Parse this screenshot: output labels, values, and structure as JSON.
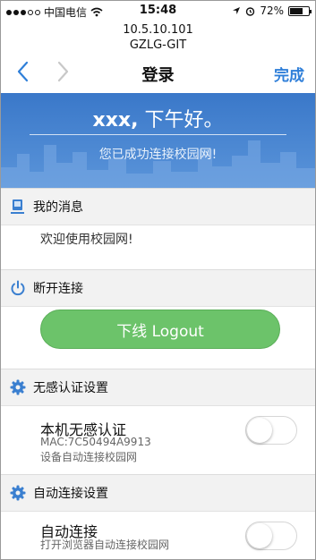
{
  "status_bar": {
    "carrier": "中国电信",
    "time": "15:48",
    "battery_percent": "72%",
    "battery_level": 0.72,
    "signal_bars_filled": 3,
    "signal_bars_total": 5
  },
  "browser": {
    "url_line1": "10.5.10.101",
    "url_line2": "GZLG-GIT"
  },
  "nav": {
    "title": "登录",
    "done_label": "完成"
  },
  "banner": {
    "name": "xxx,",
    "greeting": " 下午好。",
    "subtitle": "您已成功连接校园网!"
  },
  "messages": {
    "section_label": "我的消息",
    "content": "欢迎使用校园网!"
  },
  "disconnect": {
    "section_label": "断开连接",
    "button_label": "下线 Logout"
  },
  "seamless_auth": {
    "section_label": "无感认证设置",
    "title": "本机无感认证",
    "mac": "MAC:7C50494A9913",
    "description": "设备自动连接校园网",
    "enabled": false
  },
  "auto_connect": {
    "section_label": "自动连接设置",
    "title": "自动连接",
    "description": "打开浏览器自动连接校园网",
    "enabled": false
  },
  "colors": {
    "accent": "#2f7fd9",
    "banner": "#4a86d2",
    "logout_button": "#6cc36a",
    "section_icon": "#3a7fd0"
  }
}
